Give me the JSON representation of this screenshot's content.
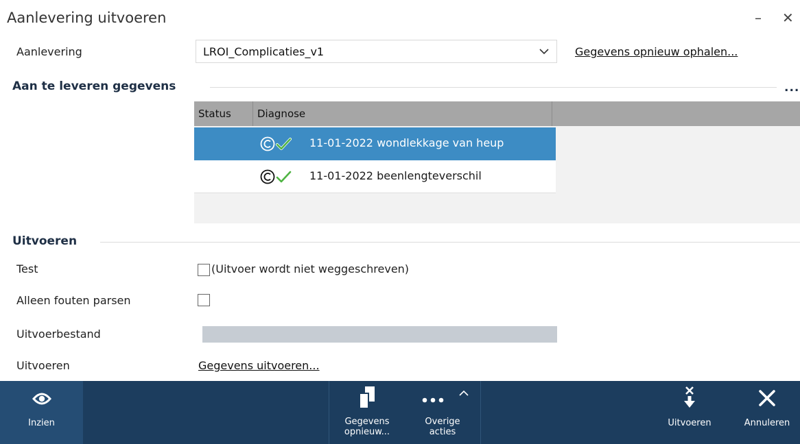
{
  "window": {
    "title": "Aanlevering uitvoeren",
    "minimize": "–",
    "close": "✕"
  },
  "aanlevering": {
    "label": "Aanlevering",
    "selected": "LROI_Complicaties_v1",
    "refresh_link": "Gegevens opnieuw ophalen..."
  },
  "data_section": {
    "title": "Aan te leveren gegevens",
    "more": "...",
    "columns": [
      "Status",
      "Diagnose"
    ],
    "rows": [
      {
        "text": "11-01-2022 wondlekkage van heup",
        "icons": [
          "copyright-icon",
          "checkmark-icon"
        ],
        "selected": true
      },
      {
        "text": "11-01-2022 beenlengteverschil",
        "icons": [
          "copyright-icon",
          "checkmark-icon"
        ],
        "selected": false
      }
    ]
  },
  "run_section": {
    "title": "Uitvoeren",
    "test_label": "Test",
    "test_hint": "(Uitvoer wordt niet weggeschreven)",
    "errors_label": "Alleen fouten parsen",
    "output_file_label": "Uitvoerbestand",
    "run_label": "Uitvoeren",
    "run_link": "Gegevens uitvoeren..."
  },
  "toolbar": {
    "view": {
      "label": "Inzien",
      "icon": "eye-icon"
    },
    "refresh": {
      "label_line1": "Gegevens",
      "label_line2": "opnieuw...",
      "icon": "copy-pages-icon"
    },
    "more": {
      "label_line1": "Overige",
      "label_line2": "acties",
      "icon": "more-dots-icon",
      "caret": "^"
    },
    "run": {
      "label": "Uitvoeren",
      "icon": "run-arrow-icon"
    },
    "cancel": {
      "label": "Annuleren",
      "icon": "close-icon"
    }
  },
  "colors": {
    "toolbar_bg": "#1c3d5e",
    "selected_row": "#3d8cc4",
    "grid_header": "#a6a6a6",
    "check_green": "#4fb443"
  }
}
